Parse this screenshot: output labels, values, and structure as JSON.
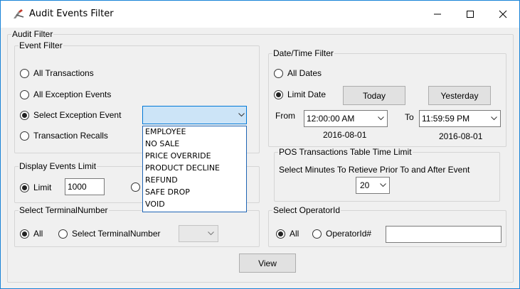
{
  "window": {
    "title": "Audit Events Filter",
    "controls": {
      "minimize": "–",
      "maximize": "☐",
      "close": "✕"
    }
  },
  "audit_filter": {
    "label": "Audit Filter"
  },
  "event_filter": {
    "label": "Event Filter",
    "options": {
      "all_transactions": "All Transactions",
      "all_exception_events": "All Exception Events",
      "select_exception_event": "Select Exception Event",
      "transaction_recalls": "Transaction Recalls"
    },
    "selected": "select_exception_event",
    "exception_combo_value": "",
    "exception_options": [
      "EMPLOYEE",
      "NO SALE",
      "PRICE OVERRIDE",
      "PRODUCT DECLINE",
      "REFUND",
      "SAFE DROP",
      "VOID"
    ]
  },
  "display_events_limit": {
    "label": "Display Events Limit",
    "limit_label": "Limit",
    "limit_value": "1000"
  },
  "select_terminal": {
    "label": "Select TerminalNumber",
    "all_label": "All",
    "select_label": "Select TerminalNumber",
    "combo_value": ""
  },
  "date_time_filter": {
    "label": "Date/Time Filter",
    "all_dates": "All Dates",
    "limit_date": "Limit Date",
    "today_button": "Today",
    "yesterday_button": "Yesterday",
    "from_label": "From",
    "from_time": "12:00:00 AM",
    "from_date": "2016-08-01",
    "to_label": "To",
    "to_time": "11:59:59 PM",
    "to_date": "2016-08-01"
  },
  "pos_time_limit": {
    "label": "POS Transactions Table Time Limit",
    "description": "Select Minutes To Retieve Prior To and After Event",
    "minutes_value": "20"
  },
  "select_operator": {
    "label": "Select OperatorId",
    "all_label": "All",
    "operator_label": "OperatorId#",
    "operator_value": ""
  },
  "view_button": "View"
}
